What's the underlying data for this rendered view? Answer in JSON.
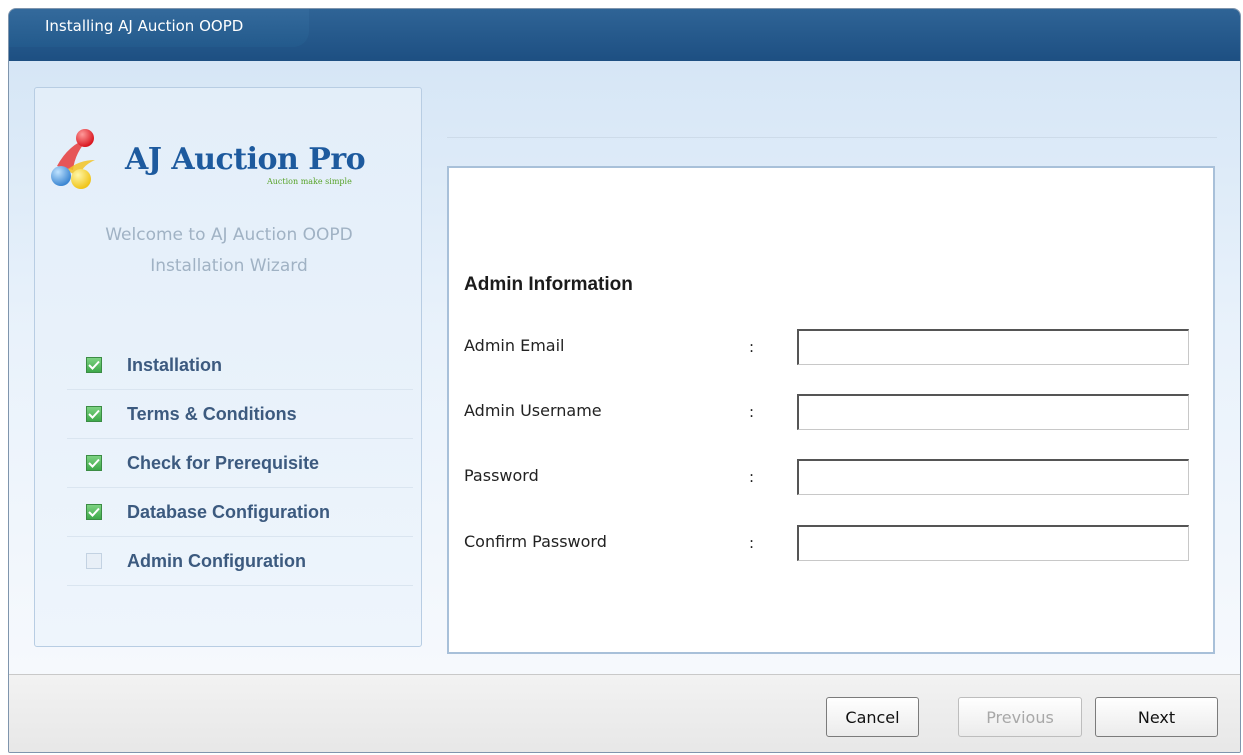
{
  "window": {
    "title": "Installing AJ Auction OOPD"
  },
  "sidebar": {
    "logo_text": "AJ Auction Pro",
    "logo_tagline": "Auction make simple",
    "welcome_line1": "Welcome to AJ Auction OOPD",
    "welcome_line2": "Installation Wizard",
    "steps": [
      {
        "label": "Installation",
        "checked": true
      },
      {
        "label": "Terms & Conditions",
        "checked": true
      },
      {
        "label": "Check for Prerequisite",
        "checked": true
      },
      {
        "label": "Database Configuration",
        "checked": true
      },
      {
        "label": "Admin Configuration",
        "checked": false
      }
    ]
  },
  "form": {
    "section_title": "Admin Information",
    "colon": ":",
    "fields": [
      {
        "label": "Admin Email",
        "value": ""
      },
      {
        "label": "Admin Username",
        "value": ""
      },
      {
        "label": "Password",
        "value": ""
      },
      {
        "label": "Confirm Password",
        "value": ""
      }
    ]
  },
  "footer": {
    "cancel_label": "Cancel",
    "previous_label": "Previous",
    "next_label": "Next"
  },
  "colors": {
    "titlebar": "#1d4f82",
    "accent_blue": "#1d5a9e",
    "checked_green": "#3ea84a",
    "step_label": "#3c5a7f"
  },
  "icons": {
    "logo": "balloons-logo-icon",
    "checked": "checkmark-icon"
  }
}
